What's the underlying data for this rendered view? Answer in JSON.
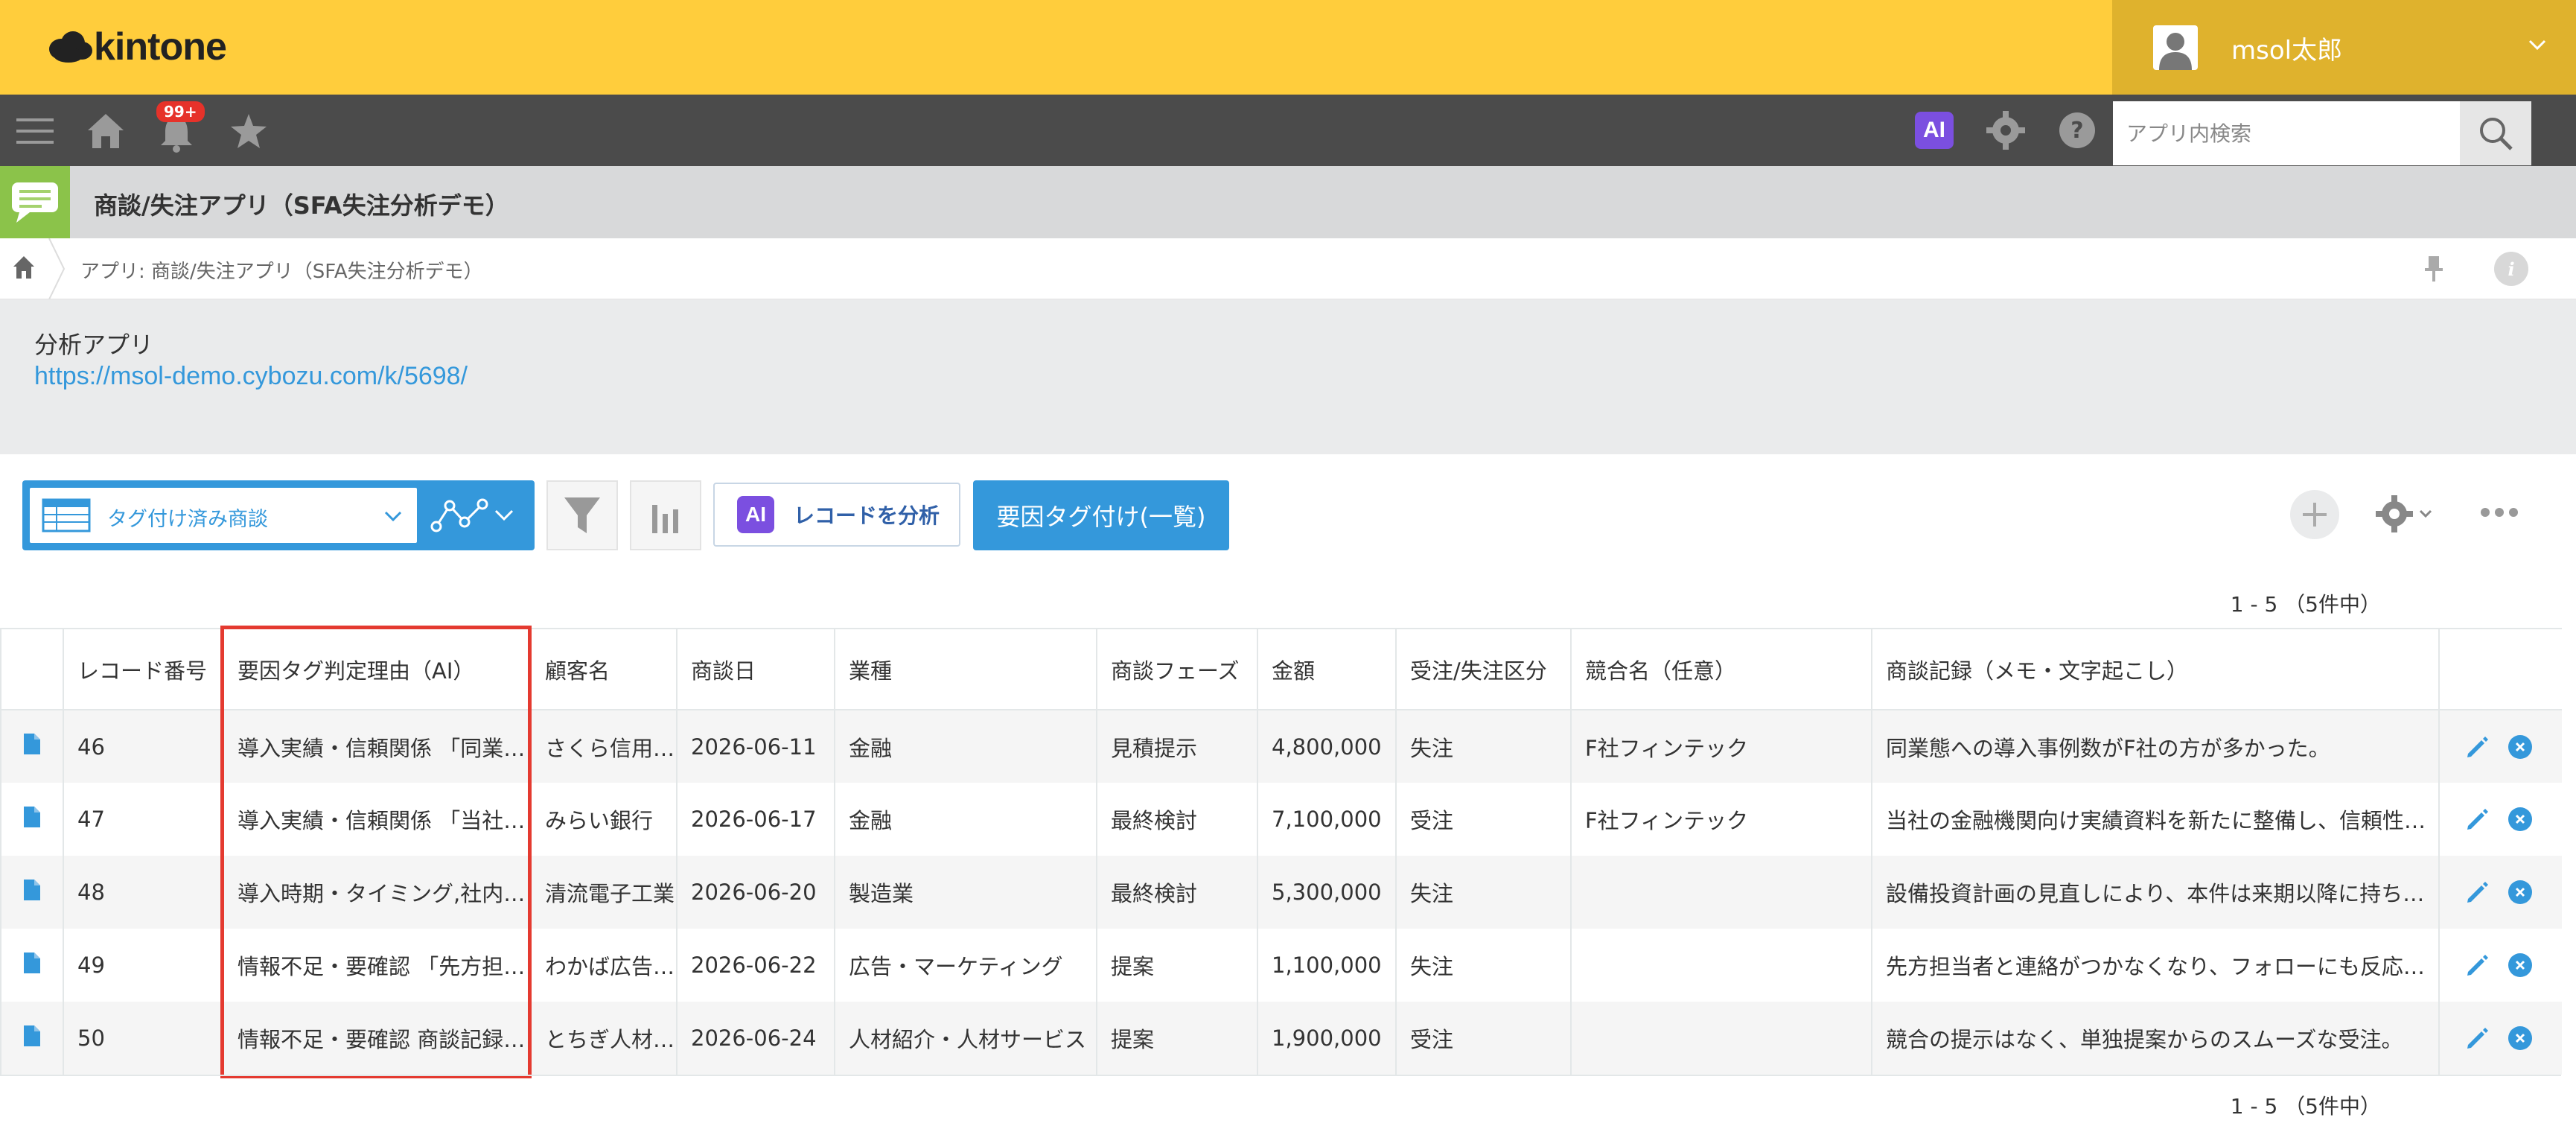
{
  "brand": {
    "logo_text": "kintone"
  },
  "user": {
    "name": "msol太郎"
  },
  "nav": {
    "notification_count": "99+",
    "ai_label": "AI",
    "search_placeholder": "アプリ内検索"
  },
  "app": {
    "title": "商談/失注アプリ（SFA失注分析デモ）",
    "breadcrumb": "アプリ: 商談/失注アプリ（SFA失注分析デモ）",
    "info_label": "i"
  },
  "description": {
    "line1": "分析アプリ",
    "link": "https://msol-demo.cybozu.com/k/5698/"
  },
  "toolbar": {
    "view_name": "タグ付け済み商談",
    "analyze_ai": "AI",
    "analyze_label": "レコードを分析",
    "tag_button": "要因タグ付け(一覧)"
  },
  "pager": {
    "top": "1 - 5 （5件中）",
    "bottom": "1 - 5 （5件中）"
  },
  "colors": {
    "accent": "#3498db",
    "topbar": "#ffcd3c",
    "ai": "#7b4fe0",
    "highlight": "#e43a30"
  },
  "table": {
    "headers": [
      "レコード番号",
      "要因タグ判定理由（AI）",
      "顧客名",
      "商談日",
      "業種",
      "商談フェーズ",
      "金額",
      "受注/失注区分",
      "競合名（任意）",
      "商談記録（メモ・文字起こし）"
    ],
    "rows": [
      [
        "46",
        "導入実績・信頼関係 「同業…",
        "さくら信用…",
        "2026-06-11",
        "金融",
        "見積提示",
        "4,800,000",
        "失注",
        "F社フィンテック",
        "同業態への導入事例数がF社の方が多かった。"
      ],
      [
        "47",
        "導入実績・信頼関係 「当社…",
        "みらい銀行",
        "2026-06-17",
        "金融",
        "最終検討",
        "7,100,000",
        "受注",
        "F社フィンテック",
        "当社の金融機関向け実績資料を新たに整備し、信頼性の…"
      ],
      [
        "48",
        "導入時期・タイミング,社内…",
        "清流電子工業",
        "2026-06-20",
        "製造業",
        "最終検討",
        "5,300,000",
        "失注",
        "",
        "設備投資計画の見直しにより、本件は来期以降に持ち越…"
      ],
      [
        "49",
        "情報不足・要確認 「先方担…",
        "わかば広告…",
        "2026-06-22",
        "広告・マーケティング",
        "提案",
        "1,100,000",
        "失注",
        "",
        "先方担当者と連絡がつかなくなり、フォローにも反応が…"
      ],
      [
        "50",
        "情報不足・要確認 商談記録…",
        "とちぎ人材…",
        "2026-06-24",
        "人材紹介・人材サービス",
        "提案",
        "1,900,000",
        "受注",
        "",
        "競合の提示はなく、単独提案からのスムーズな受注。"
      ]
    ]
  }
}
